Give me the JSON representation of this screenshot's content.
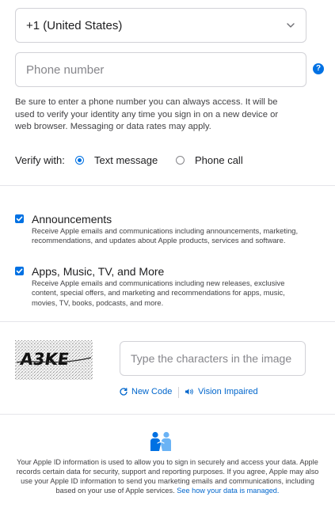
{
  "country_select": {
    "value": "+1 (United States)",
    "icon": "chevron-down-icon"
  },
  "phone": {
    "placeholder": "Phone number",
    "value": "",
    "help_icon": "question-circle-icon",
    "help_glyph": "?"
  },
  "phone_hint": "Be sure to enter a phone number you can always access. It will be used to verify your identity any time you sign in on a new device or web browser. Messaging or data rates may apply.",
  "verify": {
    "label": "Verify with:",
    "options": [
      {
        "label": "Text message",
        "selected": true
      },
      {
        "label": "Phone call",
        "selected": false
      }
    ]
  },
  "subscriptions": [
    {
      "title": "Announcements",
      "checked": true,
      "description": "Receive Apple emails and communications including announcements, marketing, recommendations, and updates about Apple products, services and software."
    },
    {
      "title": "Apps, Music, TV, and More",
      "checked": true,
      "description": "Receive Apple emails and communications including new releases, exclusive content, special offers, and marketing and recommendations for apps, music, movies, TV, books, podcasts, and more."
    }
  ],
  "captcha": {
    "image_text": "A3KE",
    "input_placeholder": "Type the characters in the image",
    "input_value": "",
    "new_code_label": "New Code",
    "vision_impaired_label": "Vision Impaired"
  },
  "footer": {
    "icon": "handshake-privacy-icon",
    "text": "Your Apple ID information is used to allow you to sign in securely and access your data. Apple records certain data for security, support and reporting purposes. If you agree, Apple may also use your Apple ID information to send you marketing emails and communications, including based on your use of Apple services. ",
    "link_text": "See how your data is managed."
  },
  "colors": {
    "accent": "#0071e3",
    "link": "#0066cc",
    "border": "#d2d2d7",
    "text": "#1d1d1f"
  }
}
